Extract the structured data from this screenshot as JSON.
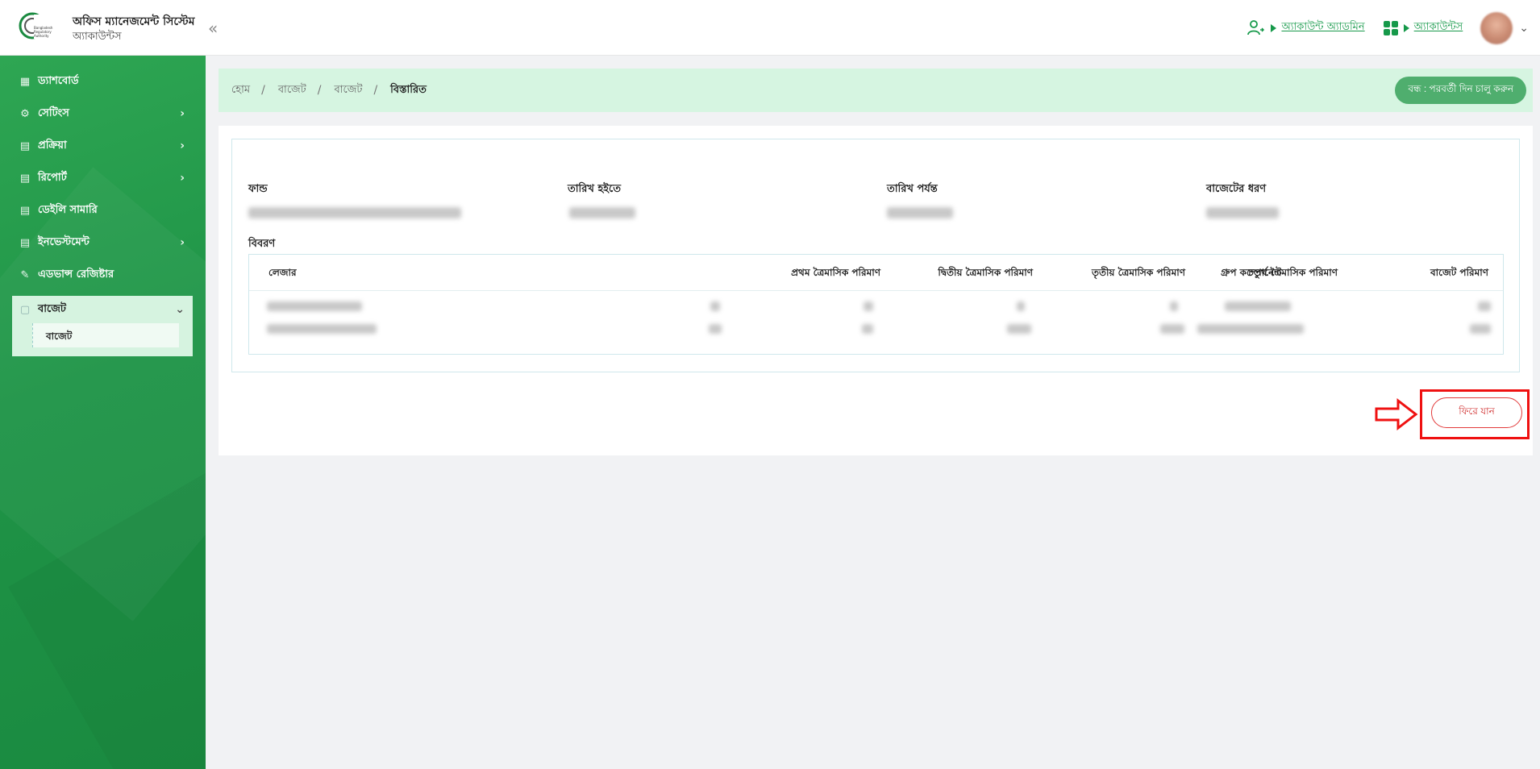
{
  "header": {
    "brand_title": "অফিস ম্যানেজমেন্ট সিস্টেম",
    "brand_sub": "অ্যাকাউন্টস",
    "logo_text": "Bangladesh Regulatory Authority",
    "collapse_icon": "«",
    "account_admin": "অ্যাকাউন্ট অ্যাডমিন",
    "accounts": "অ্যাকাউন্টস",
    "accent": "#16994a"
  },
  "sidebar": {
    "items": [
      {
        "label": "ড্যাশবোর্ড",
        "icon": "▦",
        "has_arrow": false
      },
      {
        "label": "সেটিংস",
        "icon": "⚙",
        "has_arrow": true
      },
      {
        "label": "প্রক্রিয়া",
        "icon": "▤",
        "has_arrow": true
      },
      {
        "label": "রিপোর্ট",
        "icon": "▤",
        "has_arrow": true
      },
      {
        "label": "ডেইলি সামারি",
        "icon": "▤",
        "has_arrow": false
      },
      {
        "label": "ইনভেস্টমেন্ট",
        "icon": "▤",
        "has_arrow": true
      },
      {
        "label": "এডভান্স রেজিষ্টার",
        "icon": "✎",
        "has_arrow": false
      }
    ],
    "active": {
      "label": "বাজেট",
      "sub_label": "বাজেট"
    }
  },
  "breadcrumb": {
    "items": [
      "হোম",
      "বাজেট",
      "বাজেট"
    ],
    "current": "বিস্তারিত",
    "separator": "/"
  },
  "close_button": "বন্ধ : পরবর্তী দিন চালু করুন",
  "details": {
    "fund_label": "ফান্ড",
    "date_from_label": "তারিখ হইতে",
    "date_to_label": "তারিখ পর্যন্ত",
    "budget_type_label": "বাজেটের ধরণ",
    "description_label": "বিবরণ"
  },
  "table": {
    "headers": [
      "লেজার",
      "প্রথম ত্রৈমাসিক পরিমাণ",
      "দ্বিতীয় ত্রৈমাসিক পরিমাণ",
      "তৃতীয় ত্রৈমাসিক পরিমাণ",
      "চতুর্থ ত্রৈমাসিক পরিমাণ",
      "গ্রুপ কম্পোনেন্ট",
      "বাজেট পরিমাণ"
    ]
  },
  "back_button": "ফিরে যান"
}
